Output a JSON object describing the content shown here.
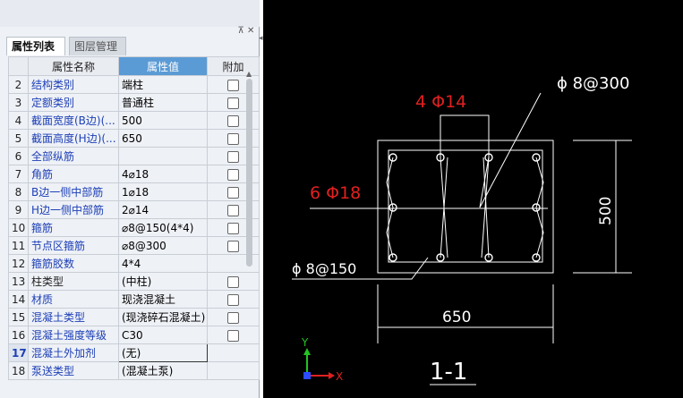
{
  "panel": {
    "tabs": [
      "属性列表",
      "图层管理"
    ],
    "pin_glyph": "⊼ ✕",
    "columns": [
      "属性名称",
      "属性值",
      "附加"
    ],
    "rows": [
      {
        "no": "2",
        "name": "结构类别",
        "value": "端柱",
        "blue": true,
        "checkbox": true
      },
      {
        "no": "3",
        "name": "定额类别",
        "value": "普通柱",
        "blue": true,
        "checkbox": true
      },
      {
        "no": "4",
        "name": "截面宽度(B边)(...",
        "value": "500",
        "blue": true,
        "checkbox": true
      },
      {
        "no": "5",
        "name": "截面高度(H边)(...",
        "value": "650",
        "blue": true,
        "checkbox": true
      },
      {
        "no": "6",
        "name": "全部纵筋",
        "value": "",
        "blue": true,
        "checkbox": true
      },
      {
        "no": "7",
        "name": "角筋",
        "value": "4⌀18",
        "blue": true,
        "checkbox": true
      },
      {
        "no": "8",
        "name": "B边一侧中部筋",
        "value": "1⌀18",
        "blue": true,
        "checkbox": true
      },
      {
        "no": "9",
        "name": "H边一侧中部筋",
        "value": "2⌀14",
        "blue": true,
        "checkbox": true
      },
      {
        "no": "10",
        "name": "箍筋",
        "value": "⌀8@150(4*4)",
        "blue": true,
        "checkbox": true
      },
      {
        "no": "11",
        "name": "节点区箍筋",
        "value": "⌀8@300",
        "blue": true,
        "checkbox": true
      },
      {
        "no": "12",
        "name": "箍筋胶数",
        "value": "4*4",
        "blue": true,
        "checkbox": false
      },
      {
        "no": "13",
        "name": "柱类型",
        "value": "(中柱)",
        "blue": false,
        "checkbox": true
      },
      {
        "no": "14",
        "name": "材质",
        "value": "现浇混凝土",
        "blue": true,
        "checkbox": true
      },
      {
        "no": "15",
        "name": "混凝土类型",
        "value": "(现浇碎石混凝土)",
        "blue": true,
        "checkbox": true
      },
      {
        "no": "16",
        "name": "混凝土强度等级",
        "value": "C30",
        "blue": true,
        "checkbox": true
      },
      {
        "no": "17",
        "name": "混凝土外加剂",
        "value": "(无)",
        "blue": true,
        "checkbox": false,
        "selected": true
      },
      {
        "no": "18",
        "name": "泵送类型",
        "value": "(混凝土泵)",
        "blue": true,
        "checkbox": false
      }
    ]
  },
  "drawing": {
    "label_top": "4 Φ14",
    "label_left": "6 Φ18",
    "label_stirrup_top": "ϕ 8@300",
    "label_stirrup_bottom": "ϕ 8@150",
    "dim_height": "500",
    "dim_width": "650",
    "section_title": "1-1",
    "axis_y": "Y",
    "axis_x": "X"
  },
  "colors": {
    "red_label": "#e02020",
    "white_line": "#ffffff",
    "axis_green": "#22c322",
    "axis_red": "#e02020",
    "axis_blue": "#2a4bff",
    "grid_header_highlight": "#5b9bd5",
    "name_link": "#1d3fb6"
  }
}
